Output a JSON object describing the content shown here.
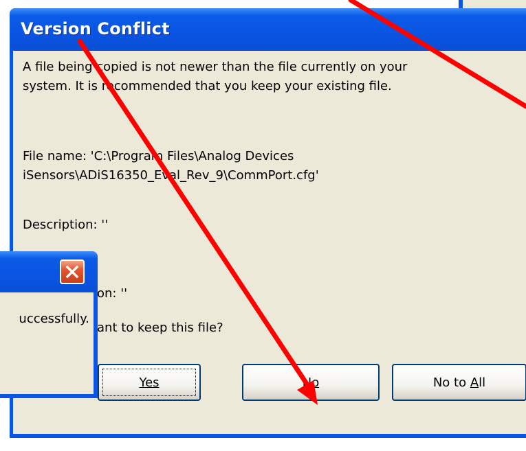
{
  "main_dialog": {
    "title": "Version Conflict",
    "message_line1": "A file being copied is not newer than the file currently on your",
    "message_line2": "system. It is recommended that you keep your existing file.",
    "file_line1": "File name:   'C:\\Program Files\\Analog Devices",
    "file_line2": "iSensors\\ADiS16350_Eval_Rev_9\\CommPort.cfg'",
    "description": "Description:  ''",
    "version": "on:  ''",
    "question": "ant to keep this file?",
    "buttons": {
      "yes": "Yes",
      "no": "No",
      "no_to_all_prefix": "No to ",
      "no_to_all_hotkey": "A",
      "no_to_all_suffix": "ll"
    }
  },
  "left_dialog": {
    "message": "uccessfully."
  },
  "icons": {
    "close": "close-icon"
  },
  "colors": {
    "title_bar": "#0a55e3",
    "window_face": "#ece9d8",
    "close_button": "#e2562f",
    "annotation_arrow": "#ff0000"
  }
}
